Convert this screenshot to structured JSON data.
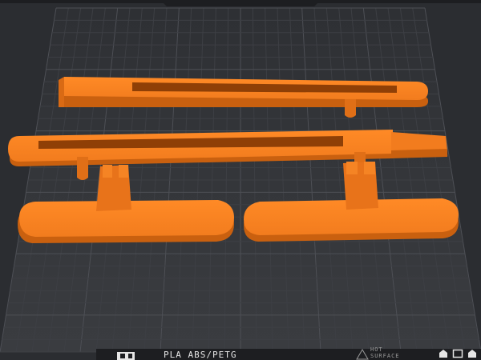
{
  "viewport": {
    "colors": {
      "background": "#2b2d31",
      "grid_minor": "#3a3c41",
      "grid_major": "#4a4c52",
      "bed": "#333539",
      "model": "#f27c1e",
      "model_shadow": "#c9600f",
      "model_dark": "#8f3f06",
      "bezel": "#1d1e21"
    },
    "plate": {
      "material_label": "PLA ABS/PETG",
      "hot_surface_line1": "HOT",
      "hot_surface_line2": "SURFACE"
    },
    "toolbar": {
      "buttons": [
        {
          "name": "home-icon"
        },
        {
          "name": "view-box-icon"
        },
        {
          "name": "layers-icon"
        }
      ]
    }
  }
}
